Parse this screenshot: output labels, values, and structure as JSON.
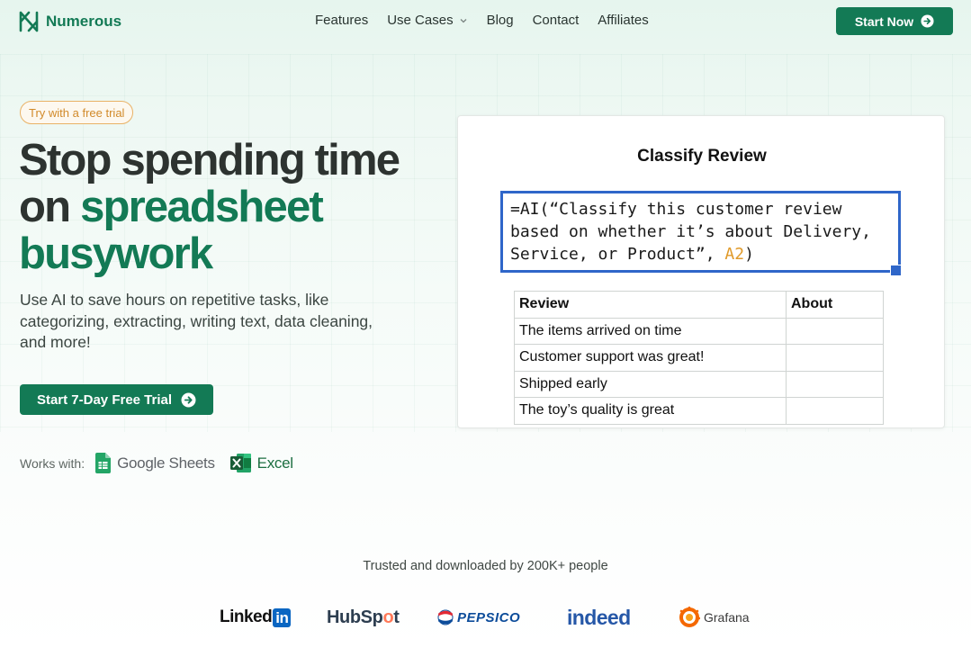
{
  "nav": {
    "brand": "Numerous",
    "links": [
      "Features",
      "Use Cases",
      "Blog",
      "Contact",
      "Affiliates"
    ],
    "cta": "Start Now"
  },
  "hero": {
    "badge": "Try with a free trial",
    "headline_part1": "Stop spending time on ",
    "headline_part2": "spreadsheet busywork",
    "subtitle": "Use AI to save hours on repetitive tasks, like categorizing, extracting, writing text, data cleaning, and more!",
    "cta": "Start 7-Day Free Trial",
    "works_with_label": "Works with:",
    "integrations": [
      "Google Sheets",
      "Excel"
    ]
  },
  "demo": {
    "title": "Classify Review",
    "formula_main": "=AI(“Classify this customer review based on whether it’s about Delivery, Service, or Product”, ",
    "formula_ref": "A2",
    "formula_end": ")",
    "table": {
      "headers": [
        "Review",
        "About"
      ],
      "rows": [
        [
          "The items arrived on time",
          ""
        ],
        [
          "Customer support was great!",
          ""
        ],
        [
          "Shipped early",
          ""
        ],
        [
          "The toy’s quality is great",
          ""
        ]
      ]
    }
  },
  "trust": {
    "text": "Trusted and downloaded by 200K+ people",
    "logos": {
      "linkedin_a": "Linked",
      "linkedin_b": "in",
      "hubspot_a": "HubSp",
      "hubspot_b": "o",
      "hubspot_c": "t",
      "pepsico": "PEPSICO",
      "indeed": "indeed",
      "grafana": "Grafana"
    }
  },
  "colors": {
    "brand": "#137a55",
    "accent_orange": "#d18a2a",
    "selection_blue": "#2f66c9"
  }
}
